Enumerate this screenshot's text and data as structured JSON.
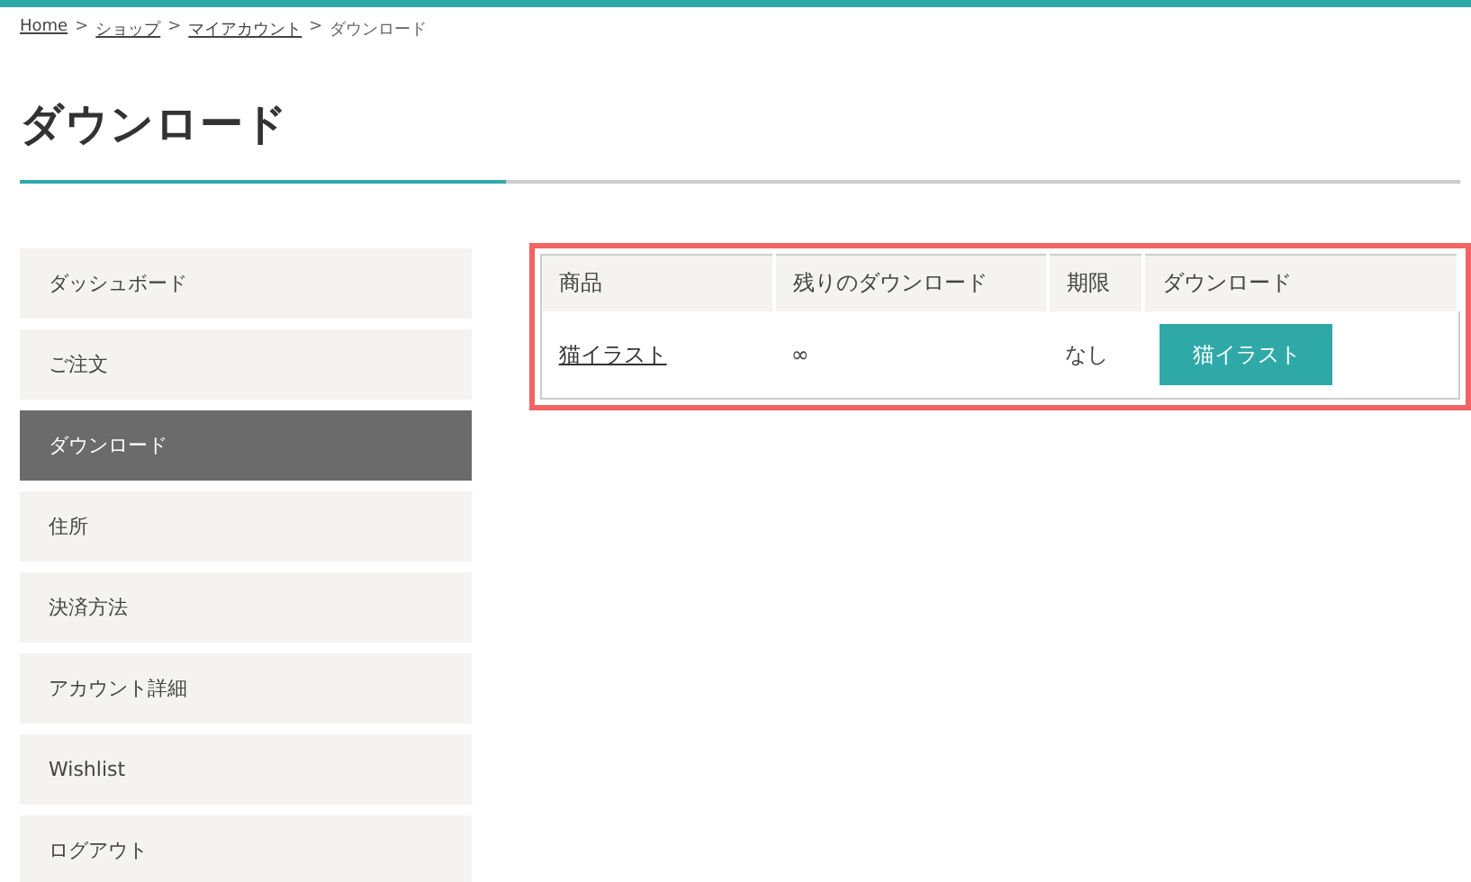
{
  "breadcrumb": {
    "separator": ">",
    "items": [
      {
        "label": "Home",
        "link": true
      },
      {
        "label": "ショップ",
        "link": true
      },
      {
        "label": "マイアカウント",
        "link": true
      },
      {
        "label": "ダウンロード",
        "link": false
      }
    ]
  },
  "title": "ダウンロード",
  "sidebar": {
    "items": [
      {
        "label": "ダッシュボード",
        "selected": false
      },
      {
        "label": "ご注文",
        "selected": false
      },
      {
        "label": "ダウンロード",
        "selected": true
      },
      {
        "label": "住所",
        "selected": false
      },
      {
        "label": "決済方法",
        "selected": false
      },
      {
        "label": "アカウント詳細",
        "selected": false
      },
      {
        "label": "Wishlist",
        "selected": false
      },
      {
        "label": "ログアウト",
        "selected": false
      }
    ]
  },
  "table": {
    "highlighted": true,
    "columns": [
      "商品",
      "残りのダウンロード",
      "期限",
      "ダウンロード"
    ],
    "rows": [
      {
        "product": "猫イラスト",
        "remaining": "∞",
        "expires": "なし",
        "download_button": "猫イラスト"
      }
    ]
  }
}
